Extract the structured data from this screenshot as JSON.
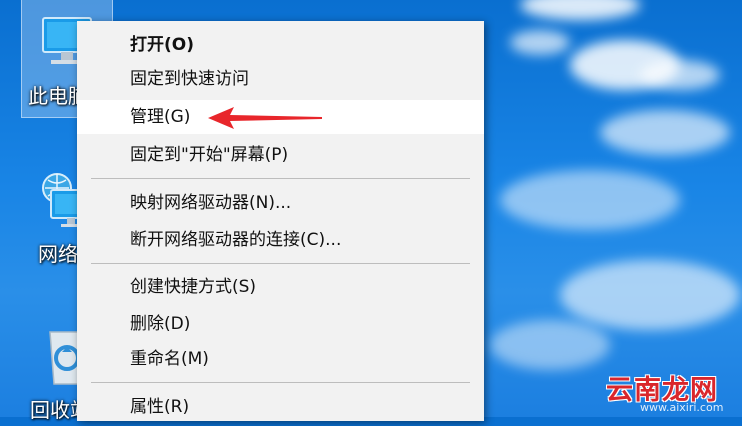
{
  "desktop": {
    "icons": [
      {
        "label": "此电脑",
        "icon": "computer-icon"
      },
      {
        "label": "网络",
        "icon": "network-icon"
      },
      {
        "label": "回收站",
        "icon": "recycle-bin-icon"
      }
    ]
  },
  "context_menu": {
    "items": [
      {
        "label": "打开(O)"
      },
      {
        "label": "固定到快速访问"
      },
      {
        "label": "管理(G)"
      },
      {
        "label": "固定到\"开始\"屏幕(P)"
      },
      {
        "label": "映射网络驱动器(N)..."
      },
      {
        "label": "断开网络驱动器的连接(C)..."
      },
      {
        "label": "创建快捷方式(S)"
      },
      {
        "label": "删除(D)"
      },
      {
        "label": "重命名(M)"
      },
      {
        "label": "属性(R)"
      }
    ]
  },
  "annotation": {
    "icon": "red-arrow-icon",
    "color": "#e8262b"
  },
  "watermark": {
    "text": "云南龙网",
    "url": "www.aixiri.com"
  }
}
